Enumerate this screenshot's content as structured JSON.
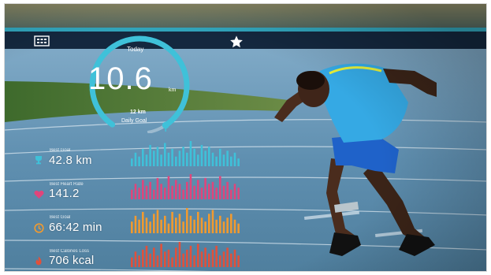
{
  "gauge": {
    "label": "Today",
    "value": "10.6",
    "unit": "km",
    "goal_value": "12 km",
    "goal_label": "Daily Goal",
    "progress": 0.883
  },
  "top_icons": {
    "left": "calendar-icon",
    "center": "star-icon"
  },
  "metrics": [
    {
      "label": "Best Goal",
      "value": "42.8 km",
      "icon": "trophy-icon",
      "color": "#3fc1d9",
      "bars": [
        4,
        7,
        5,
        9,
        6,
        11,
        8,
        10,
        6,
        12,
        7,
        9,
        5,
        8,
        10,
        7,
        13,
        9,
        6,
        11,
        8,
        10,
        7,
        5,
        9,
        6,
        8,
        5,
        7,
        4
      ]
    },
    {
      "label": "Best Heart Rate",
      "value": "141.2",
      "icon": "heart-icon",
      "color": "#e0457b",
      "bars": [
        5,
        8,
        6,
        10,
        7,
        9,
        5,
        11,
        8,
        6,
        12,
        7,
        10,
        8,
        5,
        9,
        13,
        7,
        10,
        6,
        11,
        8,
        9,
        6,
        12,
        7,
        9,
        5,
        8,
        6
      ]
    },
    {
      "label": "Best Goal",
      "value": "66:42 min",
      "icon": "clock-icon",
      "color": "#f29a2e",
      "bars": [
        6,
        9,
        7,
        11,
        8,
        6,
        10,
        12,
        7,
        9,
        5,
        11,
        8,
        10,
        6,
        13,
        9,
        7,
        11,
        8,
        6,
        10,
        12,
        7,
        9,
        6,
        8,
        10,
        7,
        5
      ]
    },
    {
      "label": "Best Calories Loss",
      "value": "706 kcal",
      "icon": "flame-icon",
      "color": "#e2503a",
      "bars": [
        5,
        8,
        6,
        9,
        11,
        7,
        10,
        6,
        12,
        8,
        9,
        5,
        10,
        13,
        7,
        9,
        11,
        6,
        12,
        8,
        10,
        7,
        9,
        11,
        6,
        8,
        10,
        7,
        9,
        6
      ]
    }
  ],
  "colors": {
    "accent": "#3fc1d9",
    "track": "#5f8fb0",
    "stands": "#1d3a55",
    "grass": "#4f7a39"
  }
}
